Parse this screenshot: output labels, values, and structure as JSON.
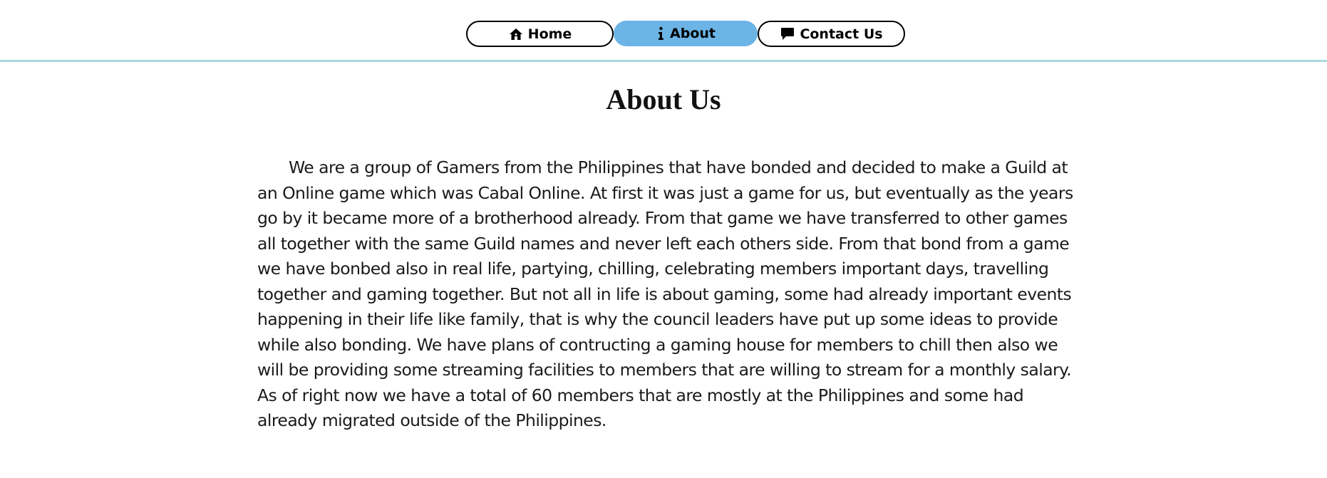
{
  "nav": {
    "items": [
      {
        "label": "Home",
        "icon": "home-icon",
        "active": false
      },
      {
        "label": "About",
        "icon": "info-icon",
        "active": true
      },
      {
        "label": "Contact Us",
        "icon": "chat-bubble-icon",
        "active": false
      }
    ],
    "active_color": "#6cb4e6",
    "divider_color": "#a8dadc"
  },
  "main": {
    "title": "About Us",
    "paragraph": "We are a group of Gamers from the Philippines that have bonded and decided to make a Guild at an Online game which was Cabal Online. At first it was just a game for us, but eventually as the years go by it became more of a brotherhood already. From that game we have transferred to other games all together with the same Guild names and never left each others side. From that bond from a game we have bonbed also in real life, partying, chilling, celebrating members important days, travelling together and gaming together. But not all in life is about gaming, some had already important events happening in their life like family, that is why the council leaders have put up some ideas to provide while also bonding. We have plans of contructing a gaming house for members to chill then also we will be providing some streaming facilities to members that are willing to stream for a monthly salary. As of right now we have a total of 60 members that are mostly at the Philippines and some had already migrated outside of the Philippines."
  }
}
